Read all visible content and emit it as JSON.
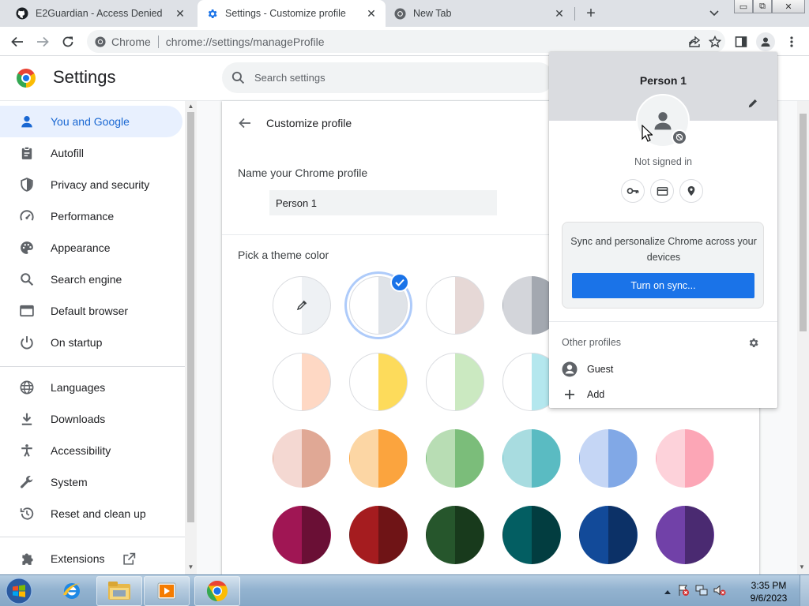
{
  "window": {
    "minimize_glyph": "▭",
    "maximize_glyph": "⧉",
    "close_glyph": "✕"
  },
  "tabs": [
    {
      "title": "E2Guardian - Access Denied",
      "icon": "github-icon",
      "active": false
    },
    {
      "title": "Settings - Customize profile",
      "icon": "settings-gear-icon",
      "active": true
    },
    {
      "title": "New Tab",
      "icon": "chrome-icon",
      "active": false
    }
  ],
  "omnibox": {
    "chip": "Chrome",
    "url": "chrome://settings/manageProfile"
  },
  "settings": {
    "title": "Settings",
    "search_placeholder": "Search settings"
  },
  "sidebar": {
    "items": [
      {
        "label": "You and Google",
        "icon": "person-icon",
        "active": true
      },
      {
        "label": "Autofill",
        "icon": "clipboard-icon"
      },
      {
        "label": "Privacy and security",
        "icon": "shield-icon"
      },
      {
        "label": "Performance",
        "icon": "speedometer-icon"
      },
      {
        "label": "Appearance",
        "icon": "palette-icon"
      },
      {
        "label": "Search engine",
        "icon": "search-icon"
      },
      {
        "label": "Default browser",
        "icon": "browser-window-icon"
      },
      {
        "label": "On startup",
        "icon": "power-icon"
      },
      {
        "label": "Languages",
        "icon": "globe-icon"
      },
      {
        "label": "Downloads",
        "icon": "download-icon"
      },
      {
        "label": "Accessibility",
        "icon": "accessibility-icon"
      },
      {
        "label": "System",
        "icon": "wrench-icon"
      },
      {
        "label": "Reset and clean up",
        "icon": "history-icon"
      },
      {
        "label": "Extensions",
        "icon": "puzzle-icon"
      }
    ]
  },
  "customize": {
    "title": "Customize profile",
    "name_label": "Name your Chrome profile",
    "name_value": "Person 1",
    "theme_label": "Pick a theme color",
    "swatches": [
      {
        "left": "#ffffff",
        "right": "#eef1f4",
        "kind": "custom"
      },
      {
        "left": "#ffffff",
        "right": "#dfe3e8",
        "selected": true
      },
      {
        "left": "#ffffff",
        "right": "#e6d8d6"
      },
      {
        "left": "#d3d5da",
        "right": "#a3a8b0"
      },
      {
        "left": "#ffffff",
        "right": "#fed8c4"
      },
      {
        "left": "#ffffff",
        "right": "#fddb5b"
      },
      {
        "left": "#ffffff",
        "right": "#cbe9c1"
      },
      {
        "left": "#ffffff",
        "right": "#b4e7ee"
      },
      {
        "left": "#f4d8d2",
        "right": "#e0a895"
      },
      {
        "left": "#fcd6a4",
        "right": "#fba43e"
      },
      {
        "left": "#b8ddb4",
        "right": "#7bbd7a"
      },
      {
        "left": "#a8dce0",
        "right": "#5abbc2"
      },
      {
        "left": "#c5d6f5",
        "right": "#81a8e6"
      },
      {
        "left": "#fdd2da",
        "right": "#fca6b6"
      },
      {
        "left": "#a01654",
        "right": "#6a0f35"
      },
      {
        "left": "#a51c1f",
        "right": "#6f1416"
      },
      {
        "left": "#26562c",
        "right": "#183a1c"
      },
      {
        "left": "#035e62",
        "right": "#023d40"
      },
      {
        "left": "#124a99",
        "right": "#0c3167"
      },
      {
        "left": "#7141a8",
        "right": "#4a2a71"
      }
    ]
  },
  "profile_menu": {
    "name": "Person 1",
    "status": "Not signed in",
    "sync_text": "Sync and personalize Chrome across your devices",
    "sync_button": "Turn on sync...",
    "other_profiles_label": "Other profiles",
    "other_profiles": [
      {
        "label": "Guest",
        "icon": "guest-icon"
      },
      {
        "label": "Add",
        "icon": "plus-icon"
      }
    ],
    "quick_icons": [
      "key-icon",
      "credit-card-icon",
      "location-pin-icon"
    ]
  },
  "taskbar": {
    "time": "3:35 PM",
    "date": "9/6/2023",
    "apps": [
      "internet-explorer-icon",
      "file-explorer-icon",
      "media-player-icon",
      "chrome-icon"
    ]
  },
  "colors": {
    "accent": "#1a73e8",
    "active_nav_bg": "#e8f0fe",
    "tabstrip": "#dee1e6"
  }
}
